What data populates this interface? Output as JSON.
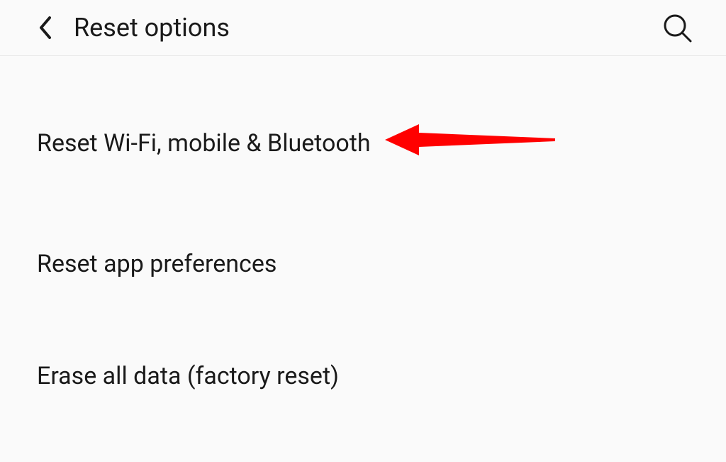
{
  "header": {
    "title": "Reset options"
  },
  "options": [
    {
      "label": "Reset Wi-Fi, mobile & Bluetooth",
      "highlighted": true
    },
    {
      "label": "Reset app preferences",
      "highlighted": false
    },
    {
      "label": "Erase all data (factory reset)",
      "highlighted": false
    }
  ]
}
